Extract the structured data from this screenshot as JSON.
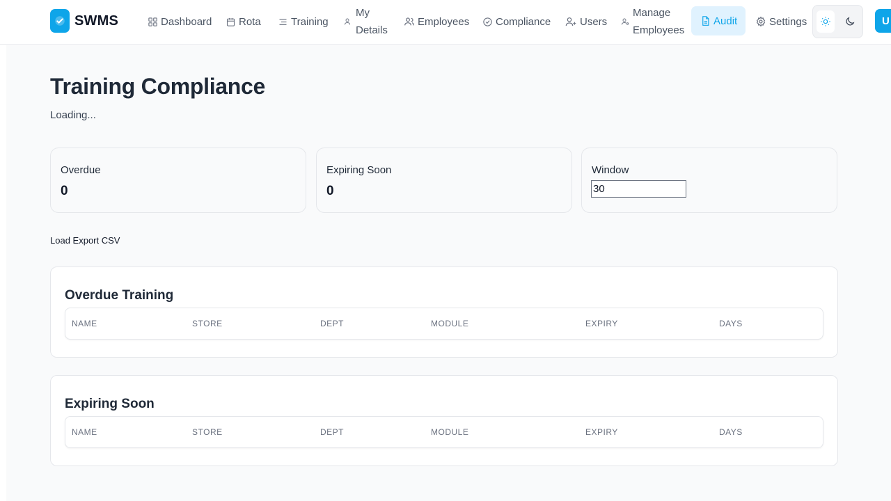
{
  "brand": {
    "name": "SWMS"
  },
  "nav": {
    "dashboard": "Dashboard",
    "rota": "Rota",
    "training": "Training",
    "my_details_1": "My",
    "my_details_2": "Details",
    "employees": "Employees",
    "compliance": "Compliance",
    "users": "Users",
    "manage_1": "Manage",
    "manage_2": "Employees",
    "audit": "Audit",
    "settings": "Settings"
  },
  "user": {
    "avatar_initial": "U"
  },
  "page": {
    "title": "Training Compliance",
    "status": "Loading..."
  },
  "stats": {
    "overdue_label": "Overdue",
    "overdue_value": "0",
    "expiring_label": "Expiring Soon",
    "expiring_value": "0",
    "window_label": "Window",
    "window_value": "30"
  },
  "actions": {
    "load": "Load",
    "export": "Export CSV"
  },
  "overdue_section": {
    "title": "Overdue Training",
    "columns": [
      "NAME",
      "STORE",
      "DEPT",
      "MODULE",
      "EXPIRY",
      "DAYS"
    ]
  },
  "expiring_section": {
    "title": "Expiring Soon",
    "columns": [
      "NAME",
      "STORE",
      "DEPT",
      "MODULE",
      "EXPIRY",
      "DAYS"
    ]
  },
  "colors": {
    "accent": "#0ea5e9",
    "accent_bg": "#e0f2fe",
    "text": "#1f2937",
    "muted": "#6b7280",
    "border": "#e5e7eb",
    "page_bg": "#f9fafb"
  },
  "icons": {
    "brand": "check-badge-icon",
    "dashboard": "grid-icon",
    "rota": "calendar-icon",
    "training": "list-icon",
    "my_details": "user-icon",
    "employees": "users-icon",
    "compliance": "check-circle-icon",
    "users": "user-plus-icon",
    "manage": "user-cog-icon",
    "audit": "file-text-icon",
    "settings": "gear-icon",
    "light": "sun-icon",
    "dark": "moon-icon"
  }
}
